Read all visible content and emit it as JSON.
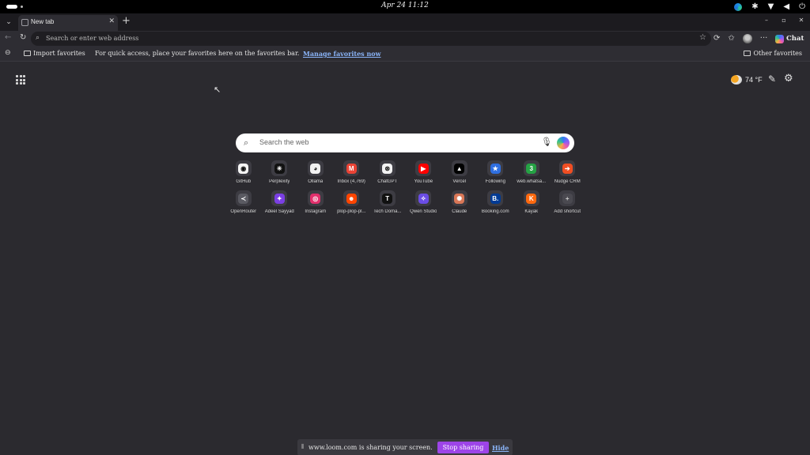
{
  "system": {
    "clock": "Apr 24  11:12",
    "tray_icons": [
      "edge-icon",
      "accessibility-icon",
      "wifi-icon",
      "volume-icon",
      "power-icon"
    ]
  },
  "browser": {
    "tab": {
      "title": "New tab"
    },
    "address_placeholder": "Search or enter web address",
    "chat_label": "Chat",
    "accent": "#8ab4f8"
  },
  "favorites_bar": {
    "import_label": "Import favorites",
    "quick_access_text": "For quick access, place your favorites here on the favorites bar.",
    "manage_link": "Manage favorites now",
    "other_favorites": "Other favorites"
  },
  "ntp": {
    "temperature": "74 °F",
    "search_placeholder": "Search the web",
    "shortcuts_row1": [
      {
        "label": "GitHub",
        "glyph": "◉",
        "color": "#f5f5f5",
        "fg": "#111"
      },
      {
        "label": "Perplexity",
        "glyph": "✳",
        "color": "#111111",
        "fg": "#fff"
      },
      {
        "label": "Ollama",
        "glyph": "◕",
        "color": "#f2f2f2",
        "fg": "#222"
      },
      {
        "label": "Inbox (4,769)",
        "glyph": "M",
        "color": "#ea4335",
        "fg": "#fff"
      },
      {
        "label": "ChatGPT",
        "glyph": "⊛",
        "color": "#f2f2f2",
        "fg": "#111"
      },
      {
        "label": "YouTube",
        "glyph": "▶",
        "color": "#ff0000",
        "fg": "#fff"
      },
      {
        "label": "Vercel",
        "glyph": "▲",
        "color": "#000000",
        "fg": "#fff"
      },
      {
        "label": "Following",
        "glyph": "★",
        "color": "#2f6fe0",
        "fg": "#fff"
      },
      {
        "label": "web.whatsa...",
        "glyph": "3",
        "color": "#25a244",
        "fg": "#fff"
      },
      {
        "label": "Nudge CRM",
        "glyph": "➔",
        "color": "#f04e23",
        "fg": "#fff"
      }
    ],
    "shortcuts_row2": [
      {
        "label": "OpenRouter",
        "glyph": "≺",
        "color": "#5a5a62",
        "fg": "#fff"
      },
      {
        "label": "Adeel Sayyad",
        "glyph": "✦",
        "color": "#7b3fe4",
        "fg": "#fff"
      },
      {
        "label": "Instagram",
        "glyph": "◎",
        "color": "#e1306c",
        "fg": "#fff"
      },
      {
        "label": "plop-plop-pl...",
        "glyph": "☻",
        "color": "#ff4500",
        "fg": "#fff"
      },
      {
        "label": "Tech Doma...",
        "glyph": "T",
        "color": "#111111",
        "fg": "#fff"
      },
      {
        "label": "Qwen Studio",
        "glyph": "✧",
        "color": "#6b4de6",
        "fg": "#fff"
      },
      {
        "label": "Claude",
        "glyph": "✺",
        "color": "#d97757",
        "fg": "#fff"
      },
      {
        "label": "Booking.com",
        "glyph": "B.",
        "color": "#003b95",
        "fg": "#fff"
      },
      {
        "label": "Kayak",
        "glyph": "K",
        "color": "#ff690f",
        "fg": "#fff"
      },
      {
        "label": "Add shortcut",
        "glyph": "+",
        "color": "#4a4950",
        "fg": "#cfcfcf"
      }
    ]
  },
  "loom": {
    "share_text": "www.loom.com is sharing your screen.",
    "stop_label": "Stop sharing",
    "hide_label": "Hide",
    "stop_color": "#9d44e8"
  }
}
